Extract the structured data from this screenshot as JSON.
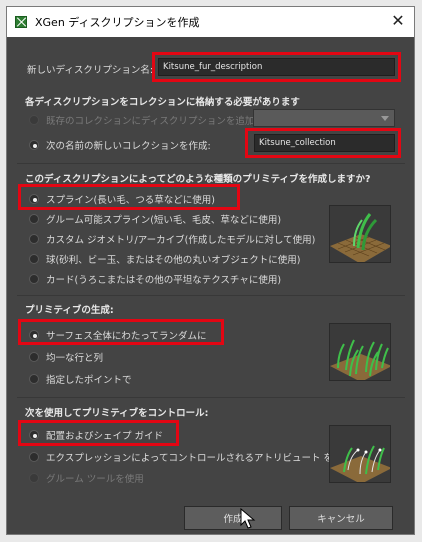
{
  "window": {
    "title": "XGen ディスクリプションを作成",
    "close_glyph": "✕"
  },
  "description_name": {
    "label": "新しいディスクリプション名:",
    "value": "Kitsune_fur_description"
  },
  "collection": {
    "heading": "各ディスクリプションをコレクションに格納する必要があります",
    "option_existing": "既存のコレクションにディスクリプションを追加:",
    "option_new": "次の名前の新しいコレクションを作成:",
    "new_value": "Kitsune_collection"
  },
  "primitive_type": {
    "heading": "このディスクリプションによってどのような種類のプリミティブを作成しますか?",
    "options": [
      "スプライン(長い毛、つる草などに使用)",
      "グルーム可能スプライン(短い毛、毛皮、草などに使用)",
      "カスタム ジオメトリ/アーカイブ(作成したモデルに対して使用)",
      "球(砂利、ビー玉、またはその他の丸いオブジェクトに使用)",
      "カード(うろこまたはその他の平坦なテクスチャに使用)"
    ]
  },
  "generate": {
    "heading": "プリミティブの生成:",
    "options": [
      "サーフェス全体にわたってランダムに",
      "均一な行と列",
      "指定したポイントで"
    ]
  },
  "control": {
    "heading": "次を使用してプリミティブをコントロール:",
    "options": [
      "配置およびシェイプ ガイド",
      "エクスプレッションによってコントロールされるアトリビュート を使用",
      "グルーム ツールを使用"
    ]
  },
  "buttons": {
    "create": "作成",
    "cancel": "キャンセル"
  },
  "colors": {
    "highlight": "#e30613",
    "panel": "#444444",
    "titlebar": "#ffffff"
  }
}
